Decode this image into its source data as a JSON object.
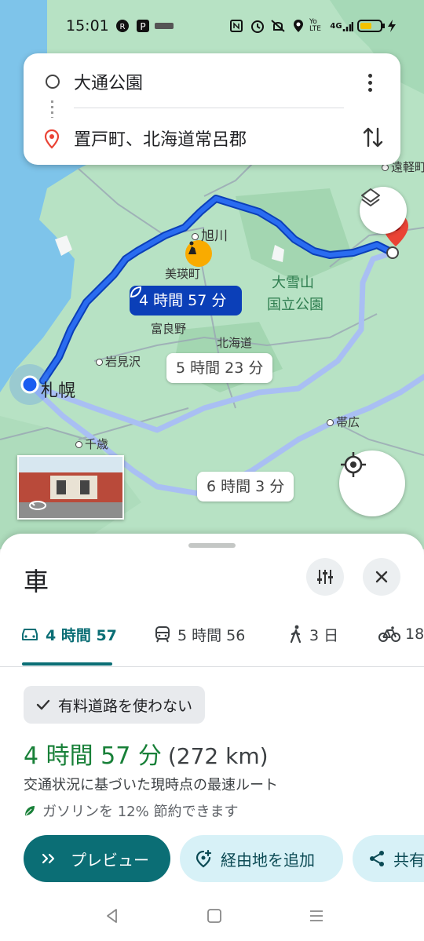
{
  "status_bar": {
    "time": "15:01",
    "icons": [
      "R-badge-icon",
      "parking-icon",
      "shop-icon",
      "nfc-icon",
      "alarm-icon",
      "mute-icon",
      "location-icon",
      "volte-icon",
      "signal-icon",
      "battery-icon",
      "charging-icon"
    ],
    "volte_text": "Yo LTE",
    "signal_text": "4G"
  },
  "search": {
    "origin": "大通公園",
    "destination": "置戸町、北海道常呂郡"
  },
  "map": {
    "labels": {
      "asahikawa": "旭川",
      "biei": "美瑛町",
      "daisetsuzan": "大雪山",
      "kokuritsu": "国立公園",
      "furano": "富良野",
      "hokkaido": "北海道",
      "iwamizawa": "岩見沢",
      "sapporo": "札幌",
      "chitose": "千歳",
      "obihiro": "帯広",
      "engaru": "遠軽町"
    },
    "route_main": "4 時間 57 分",
    "route_alt1": "5 時間 23 分",
    "route_alt2": "6 時間 3 分",
    "colors": {
      "route": "#1a4fd6",
      "route_alt": "#a9bff3",
      "land": "#b7e2c4",
      "sea": "#7ec4ea"
    }
  },
  "sheet": {
    "title": "車",
    "modes": [
      {
        "icon": "car-icon",
        "label": "4 時間 57"
      },
      {
        "icon": "train-icon",
        "label": "5 時間 56"
      },
      {
        "icon": "walk-icon",
        "label": "3 日"
      },
      {
        "icon": "bike-icon",
        "label": "18"
      }
    ],
    "chip": "有料道路を使わない",
    "duration": "4 時間 57 分",
    "distance": "(272 km)",
    "description": "交通状況に基づいた現時点の最速ルート",
    "eco": "ガソリンを 12% 節約できます",
    "buttons": {
      "preview": "プレビュー",
      "add_stop": "経由地を追加",
      "share": "共有"
    },
    "colors": {
      "accent": "#0b6e75",
      "green": "#188038"
    }
  }
}
